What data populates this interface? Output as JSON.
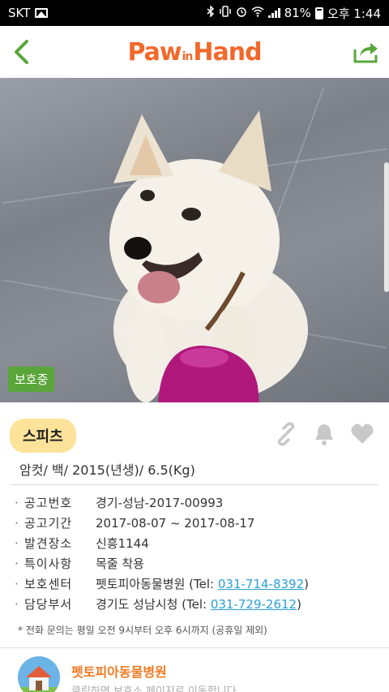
{
  "status_bar": {
    "carrier": "SKT",
    "battery": "81%",
    "time": "오후 1:44"
  },
  "header": {
    "logo": "PawinHand",
    "logo_part1": "Paw",
    "logo_part2": "in",
    "logo_part3": "Hand"
  },
  "photo": {
    "status_badge": "보호중"
  },
  "animal": {
    "breed": "스피츠",
    "summary": "암컷/ 백/ 2015(년생)/ 6.5(Kg)"
  },
  "info": [
    {
      "label": "공고번호",
      "value": "경기-성남-2017-00993"
    },
    {
      "label": "공고기간",
      "value": "2017-08-07 ~ 2017-08-17"
    },
    {
      "label": "발견장소",
      "value": "신흥1144"
    },
    {
      "label": "특이사항",
      "value": "목줄 착용"
    },
    {
      "label": "보호센터",
      "value": "펫토피아동물병원 (Tel: ",
      "tel": "031-714-8392",
      "tail": ")"
    },
    {
      "label": "담당부서",
      "value": "경기도 성남시청 (Tel: ",
      "tel": "031-729-2612",
      "tail": ")"
    }
  ],
  "note": "* 전화 문의는 평일 오전 9시부터 오후 6시까지 (공휴일 제외)",
  "bottom_card": {
    "center_name": "펫토피아동물병원",
    "subtitle": "클릭하면 보호소 페이지로 이동합니다"
  },
  "colors": {
    "brand": "#f2682b",
    "accent_green": "#5aa63a",
    "badge_yellow": "#fde39a",
    "link_blue": "#2a9fd6"
  }
}
